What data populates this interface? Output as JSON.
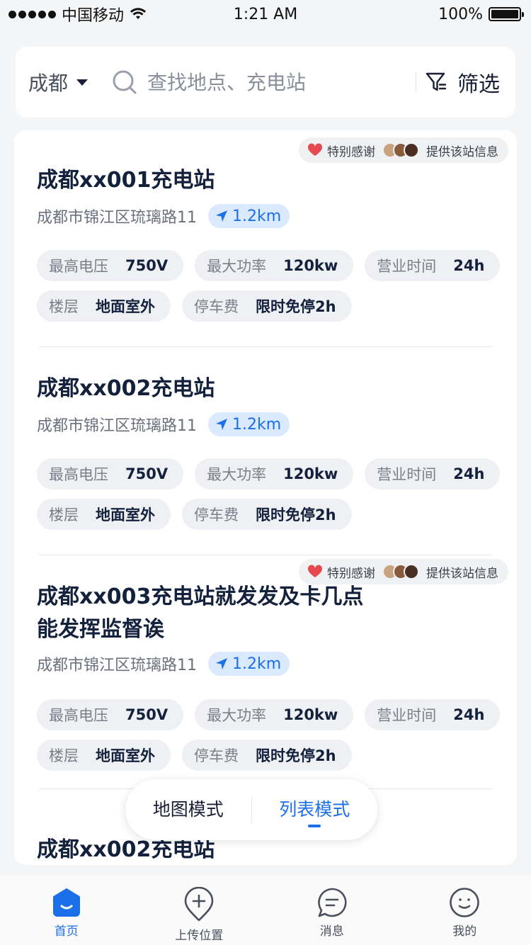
{
  "status_bar": {
    "carrier": "中国移动",
    "time": "1:21 AM",
    "battery": "100%"
  },
  "search": {
    "city": "成都",
    "placeholder": "查找地点、充电站",
    "filter_label": "筛选"
  },
  "thanks": {
    "prefix": "特别感谢",
    "suffix": "提供该站信息"
  },
  "stations": [
    {
      "name": "成都xx001充电站",
      "address": "成都市锦江区琉璃路11",
      "distance": "1.2km",
      "specs": [
        {
          "label": "最高电压",
          "value": "750V"
        },
        {
          "label": "最大功率",
          "value": "120kw"
        },
        {
          "label": "营业时间",
          "value": "24h"
        },
        {
          "label": "楼层",
          "value": "地面室外"
        },
        {
          "label": "停车费",
          "value": "限时免停2h"
        }
      ]
    },
    {
      "name": "成都xx002充电站",
      "address": "成都市锦江区琉璃路11",
      "distance": "1.2km",
      "specs": [
        {
          "label": "最高电压",
          "value": "750V"
        },
        {
          "label": "最大功率",
          "value": "120kw"
        },
        {
          "label": "营业时间",
          "value": "24h"
        },
        {
          "label": "楼层",
          "value": "地面室外"
        },
        {
          "label": "停车费",
          "value": "限时免停2h"
        }
      ]
    },
    {
      "name": "成都xx003充电站就发发及卡几点能发挥监督诶",
      "address": "成都市锦江区琉璃路11",
      "distance": "1.2km",
      "specs": [
        {
          "label": "最高电压",
          "value": "750V"
        },
        {
          "label": "最大功率",
          "value": "120kw"
        },
        {
          "label": "营业时间",
          "value": "24h"
        },
        {
          "label": "楼层",
          "value": "地面室外"
        },
        {
          "label": "停车费",
          "value": "限时免停2h"
        }
      ]
    },
    {
      "name": "成都xx002充电站"
    }
  ],
  "mode_switch": {
    "map": "地图模式",
    "list": "列表模式",
    "selected": "列表模式"
  },
  "tabbar": [
    {
      "label": "首页",
      "icon": "home-icon",
      "active": true
    },
    {
      "label": "上传位置",
      "icon": "add-location-icon",
      "active": false
    },
    {
      "label": "消息",
      "icon": "message-icon",
      "active": false
    },
    {
      "label": "我的",
      "icon": "profile-icon",
      "active": false
    }
  ],
  "colors": {
    "accent": "#1b6fe8",
    "distance_bg": "#dbe9ff",
    "title": "#14213d",
    "heart": "#e5484d"
  }
}
